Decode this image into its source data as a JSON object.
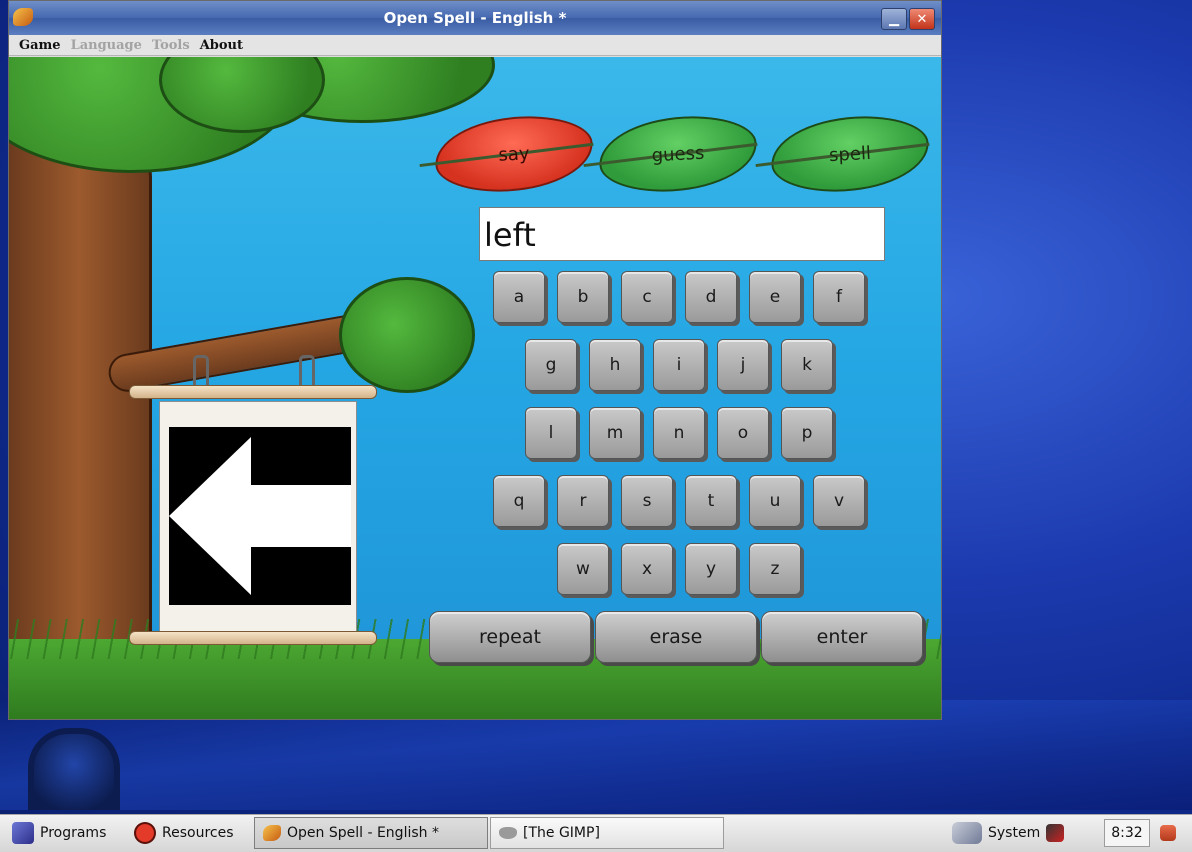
{
  "window": {
    "title": "Open Spell - English *",
    "minimize_glyph": "▁",
    "close_glyph": "✕"
  },
  "menu": {
    "items": [
      {
        "label": "Game",
        "enabled": true
      },
      {
        "label": "Language",
        "enabled": false
      },
      {
        "label": "Tools",
        "enabled": false
      },
      {
        "label": "About",
        "enabled": true
      }
    ]
  },
  "game": {
    "mode_leaves": [
      {
        "label": "say",
        "active": true,
        "color": "#e5432c"
      },
      {
        "label": "guess",
        "active": false,
        "color": "#3fb04a"
      },
      {
        "label": "spell",
        "active": false,
        "color": "#3fb04a"
      }
    ],
    "word": "left",
    "sign_picture_icon": "left-arrow-icon",
    "keyboard_rows": [
      [
        "a",
        "b",
        "c",
        "d",
        "e",
        "f"
      ],
      [
        "g",
        "h",
        "i",
        "j",
        "k"
      ],
      [
        "l",
        "m",
        "n",
        "o",
        "p"
      ],
      [
        "q",
        "r",
        "s",
        "t",
        "u",
        "v"
      ],
      [
        "w",
        "x",
        "y",
        "z"
      ]
    ],
    "actions": {
      "repeat": "repeat",
      "erase": "erase",
      "enter": "enter"
    }
  },
  "taskbar": {
    "programs": "Programs",
    "resources": "Resources",
    "tasks": [
      {
        "label": "Open Spell - English *",
        "active": true
      },
      {
        "label": "[The GIMP]",
        "active": false
      }
    ],
    "system": "System",
    "clock": "8:32"
  }
}
